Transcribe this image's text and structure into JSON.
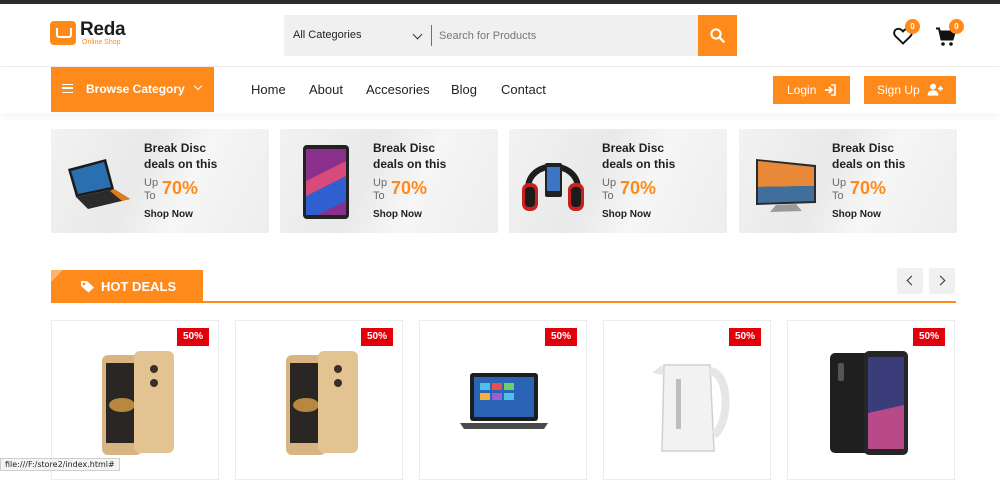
{
  "brand": {
    "name": "Reda",
    "tagline": "Online Shop",
    "accent_color": "#ff8a1c"
  },
  "search": {
    "category": "All Categories",
    "placeholder": "Search for Products",
    "button_icon": "search-icon"
  },
  "header_icons": {
    "wishlist_icon": "heart-icon",
    "wishlist_count": "0",
    "cart_icon": "cart-icon",
    "cart_count": "0"
  },
  "nav": {
    "browse_label": "Browse Category",
    "links": [
      "Home",
      "About",
      "Accesories",
      "Blog",
      "Contact"
    ],
    "login_label": "Login",
    "signup_label": "Sign Up"
  },
  "promos": [
    {
      "title_1": "Break Disc",
      "title_2": "deals on this",
      "up": "Up",
      "to": "To",
      "percent": "70%",
      "cta": "Shop Now",
      "icon": "laptop-icon"
    },
    {
      "title_1": "Break Disc",
      "title_2": "deals on this",
      "up": "Up",
      "to": "To",
      "percent": "70%",
      "cta": "Shop Now",
      "icon": "tablet-icon"
    },
    {
      "title_1": "Break Disc",
      "title_2": "deals on this",
      "up": "Up",
      "to": "To",
      "percent": "70%",
      "cta": "Shop Now",
      "icon": "headphones-icon"
    },
    {
      "title_1": "Break Disc",
      "title_2": "deals on this",
      "up": "Up",
      "to": "To",
      "percent": "70%",
      "cta": "Shop Now",
      "icon": "monitor-icon"
    }
  ],
  "hot_deals": {
    "title": "HOT DEALS",
    "products": [
      {
        "discount": "50%",
        "icon": "gold-phone-icon"
      },
      {
        "discount": "50%",
        "icon": "gold-phone-icon"
      },
      {
        "discount": "50%",
        "icon": "laptop-icon"
      },
      {
        "discount": "50%",
        "icon": "kettle-icon"
      },
      {
        "discount": "50%",
        "icon": "black-phone-icon"
      }
    ]
  },
  "status_bar": {
    "url": "file:///F:/store2/index.html#"
  }
}
